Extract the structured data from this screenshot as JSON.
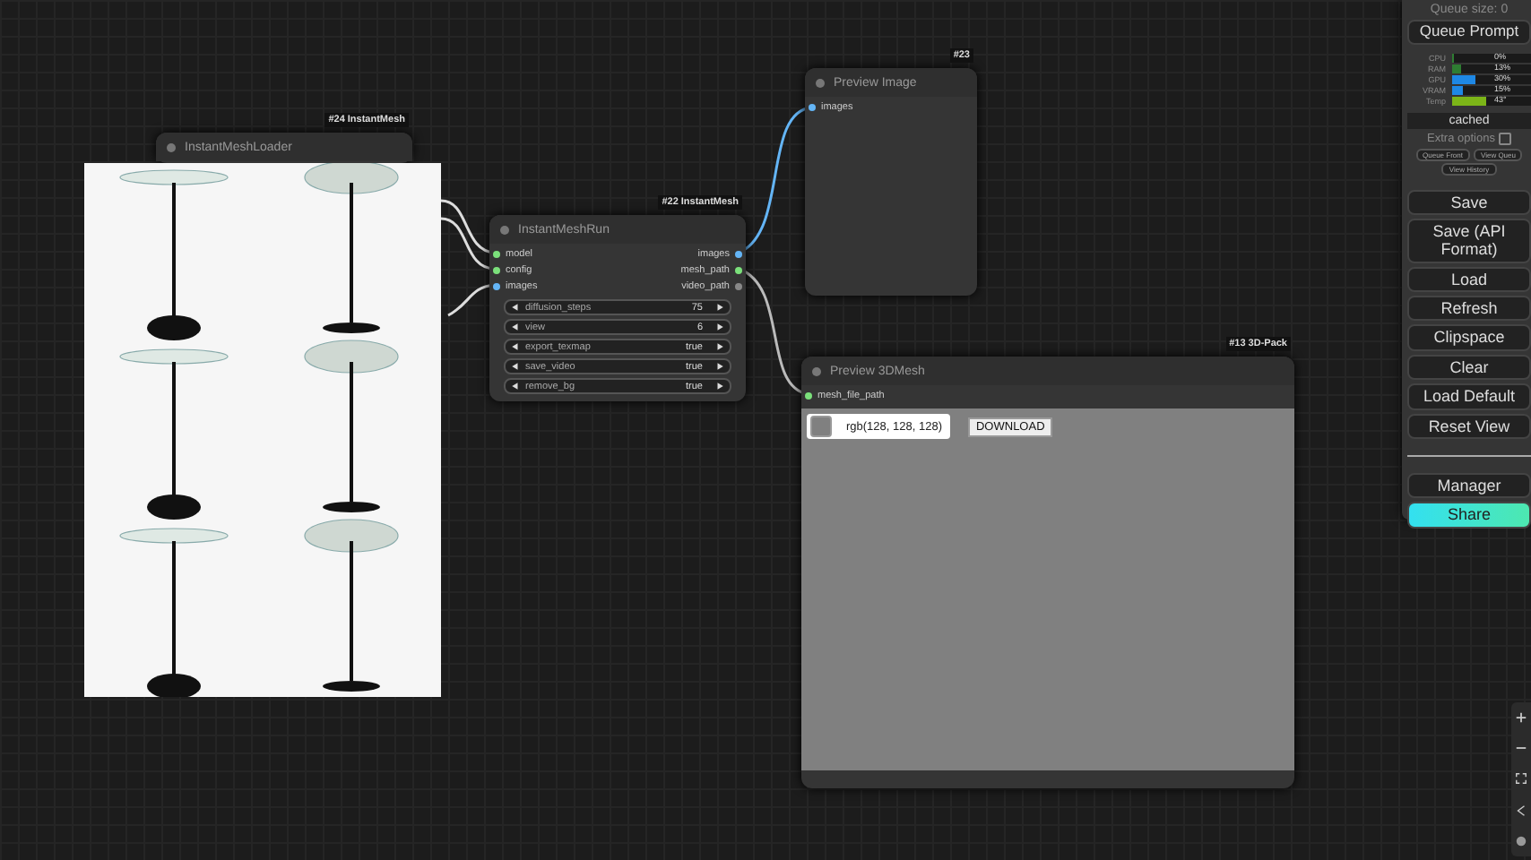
{
  "nodes": [
    {
      "kind": "loader",
      "badge": "#24 InstantMesh",
      "title": "InstantMeshLoader"
    },
    {
      "kind": "run",
      "badge": "#22 InstantMesh",
      "title": "InstantMeshRun",
      "inputs": [
        {
          "label": "model",
          "color": "#7be07b"
        },
        {
          "label": "config",
          "color": "#7be07b"
        },
        {
          "label": "images",
          "color": "#64b5f6"
        }
      ],
      "outputs": [
        {
          "label": "images",
          "color": "#64b5f6"
        },
        {
          "label": "mesh_path",
          "color": "#7be07b"
        },
        {
          "label": "video_path",
          "color": "#888888"
        }
      ],
      "widgets": [
        {
          "name": "diffusion_steps",
          "value": "75"
        },
        {
          "name": "view",
          "value": "6"
        },
        {
          "name": "export_texmap",
          "value": "true"
        },
        {
          "name": "save_video",
          "value": "true"
        },
        {
          "name": "remove_bg",
          "value": "true"
        }
      ]
    },
    {
      "kind": "preview_image",
      "badge": "#23",
      "title": "Preview Image",
      "inputs": [
        {
          "label": "images",
          "color": "#64b5f6"
        }
      ]
    },
    {
      "kind": "preview_mesh",
      "badge": "#13 3D-Pack",
      "title": "Preview 3DMesh",
      "inputs": [
        {
          "label": "mesh_file_path",
          "color": "#7be07b"
        }
      ],
      "color_field": "rgb(128, 128, 128)",
      "download": "DOWNLOAD"
    }
  ],
  "panel": {
    "queue_size": "Queue size: 0",
    "queue_button": "Queue Prompt",
    "meters": [
      {
        "label": "CPU",
        "level": 0,
        "reading": "0%",
        "color": "#2e7d32"
      },
      {
        "label": "RAM",
        "level": 0.13,
        "reading": "13%",
        "color": "#2e7d32"
      },
      {
        "label": "GPU",
        "level": 0.3,
        "reading": "30%",
        "color": "#1e88e5"
      },
      {
        "label": "VRAM",
        "level": 0.15,
        "reading": "15%",
        "color": "#1e88e5"
      },
      {
        "label": "Temp",
        "level": 0.43,
        "reading": "43°",
        "color": "#7cb518"
      }
    ],
    "status": "cached",
    "extra_options": {
      "label": "Extra options",
      "checked": false
    },
    "small_buttons": [
      "Queue Front",
      "View Queu",
      "View History"
    ],
    "buttons": [
      {
        "label": "Save",
        "kind": "normal"
      },
      {
        "label": "Save (API Format)",
        "kind": "normal"
      },
      {
        "label": "Load",
        "kind": "normal"
      },
      {
        "label": "Refresh",
        "kind": "normal"
      },
      {
        "label": "Clipspace",
        "kind": "normal"
      },
      {
        "label": "Clear",
        "kind": "normal"
      },
      {
        "label": "Load Default",
        "kind": "normal"
      },
      {
        "label": "Reset View",
        "kind": "normal"
      },
      {
        "kind": "divider"
      },
      {
        "label": "Manager",
        "kind": "normal"
      },
      {
        "label": "Share",
        "kind": "share"
      }
    ]
  }
}
